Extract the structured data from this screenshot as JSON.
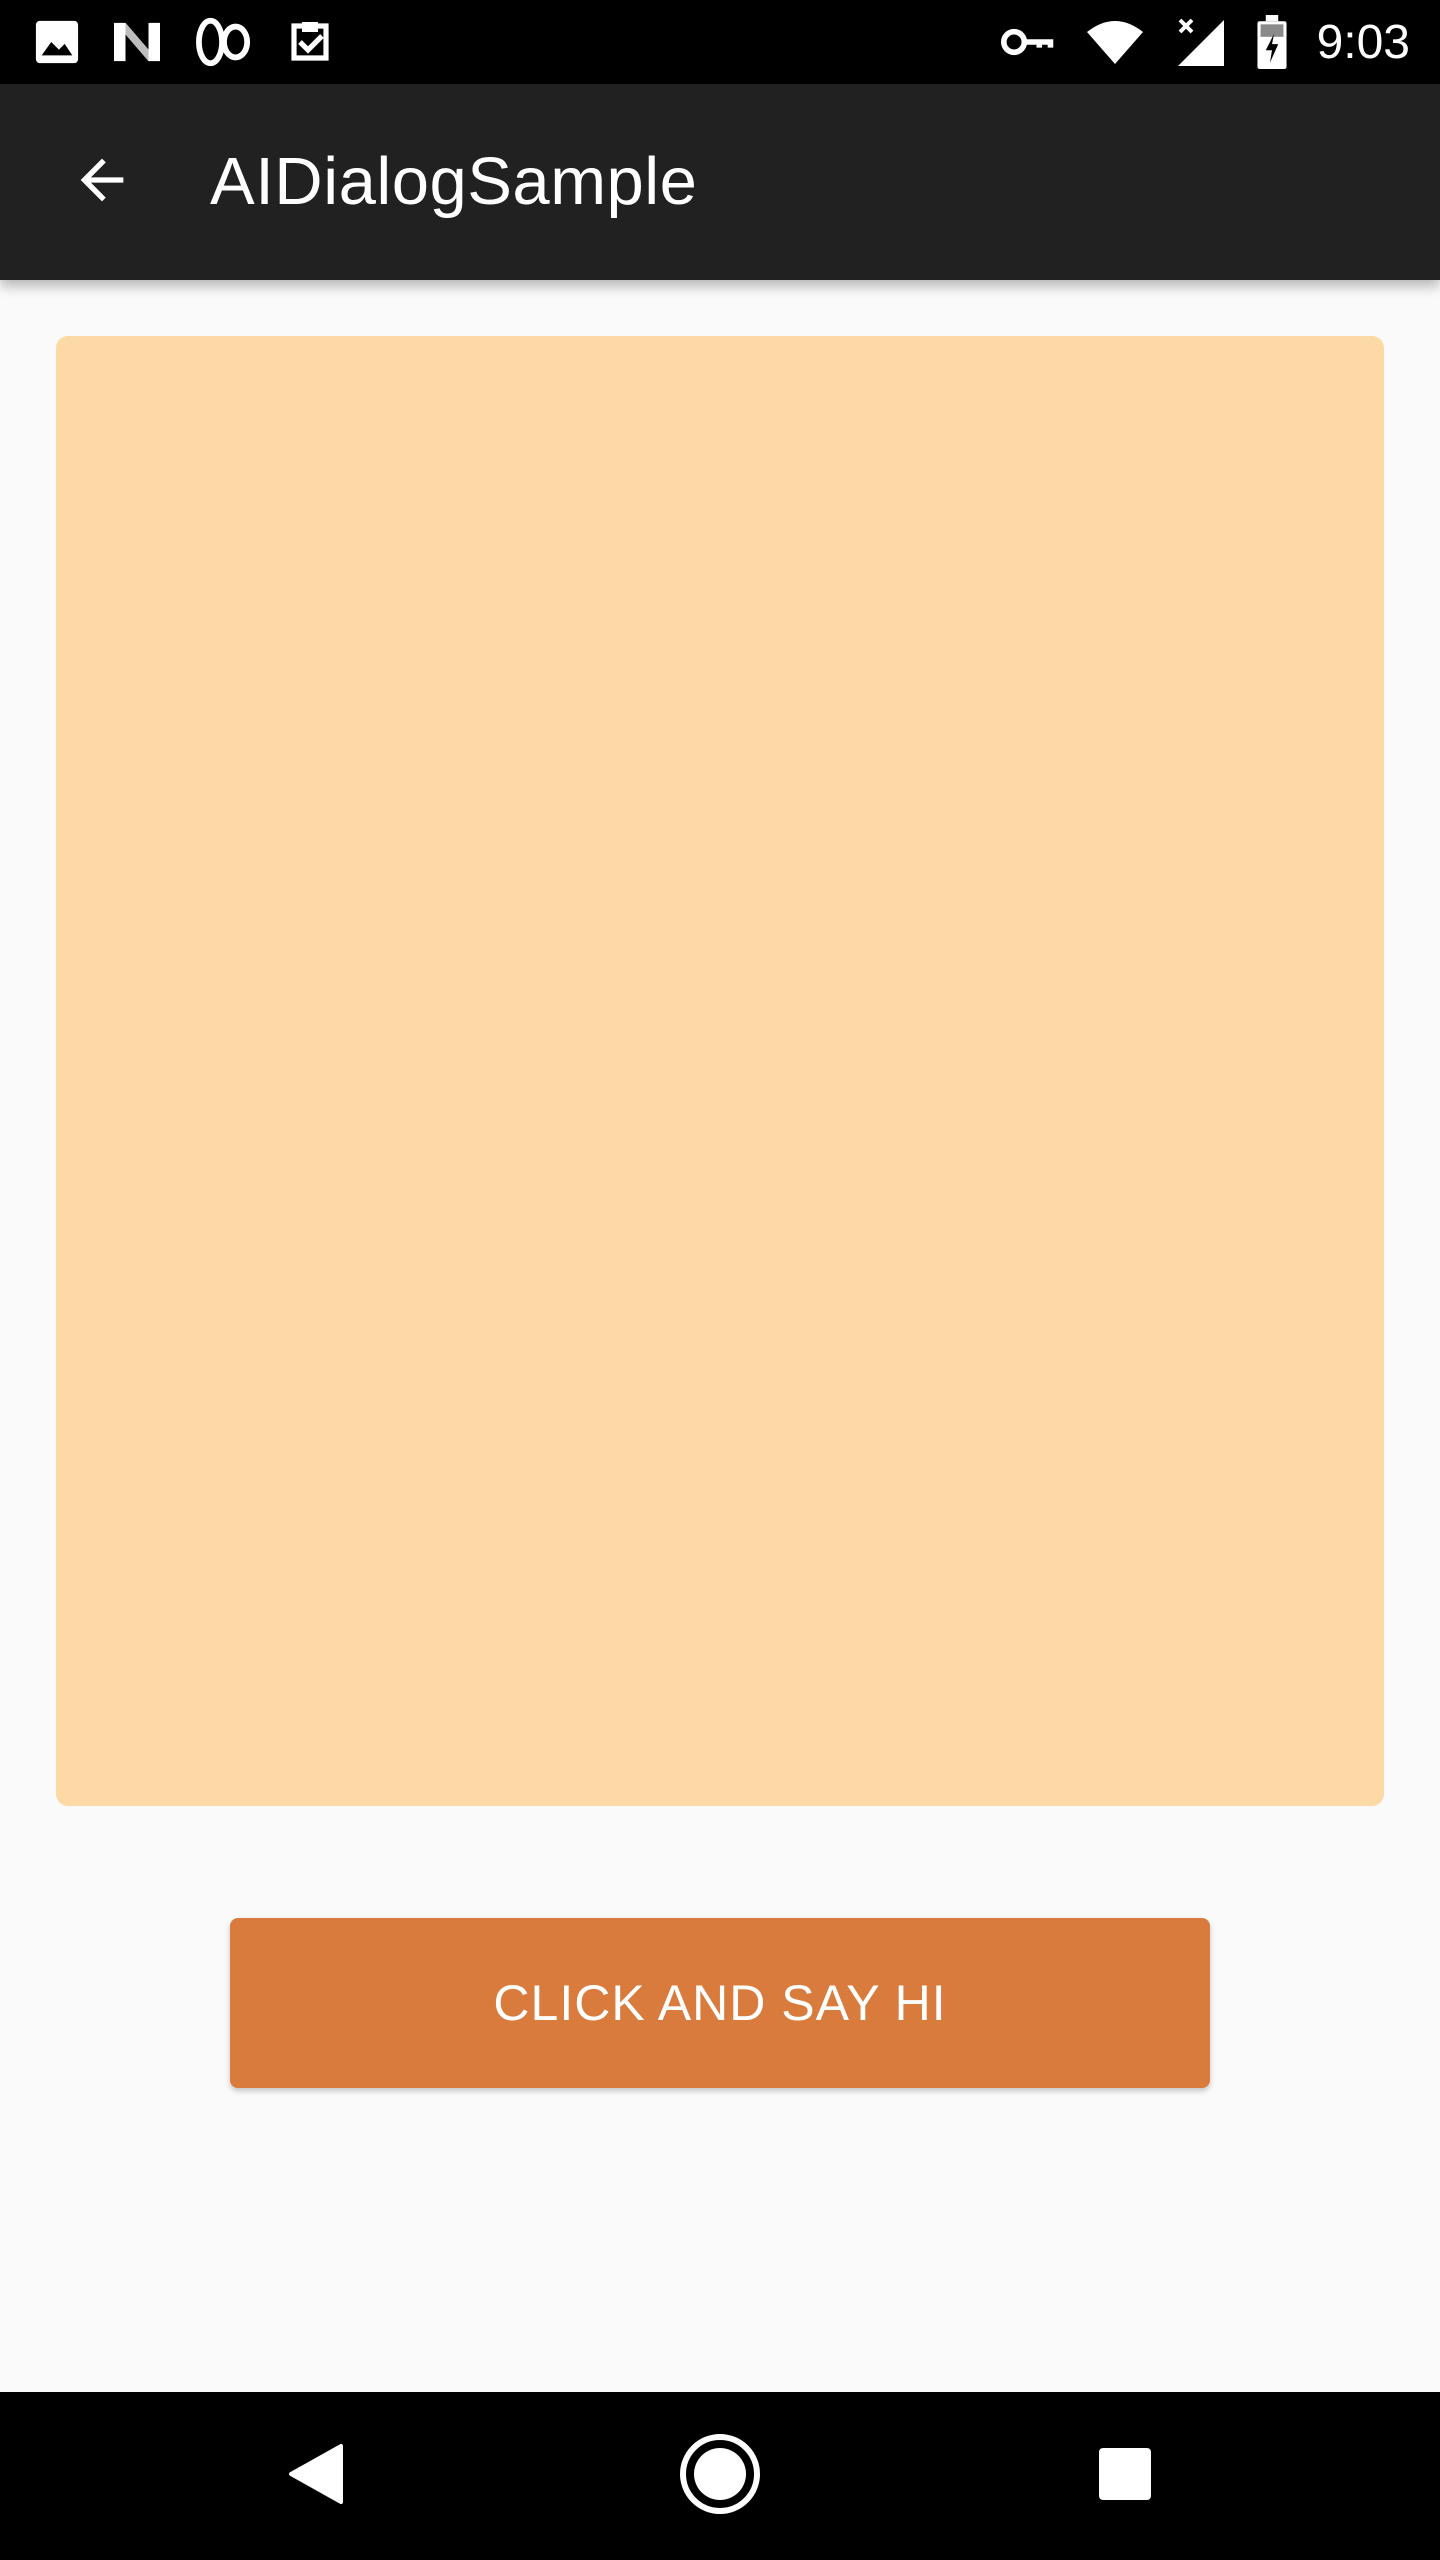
{
  "status_bar": {
    "time": "9:03",
    "left_icons": [
      "image-icon",
      "n-logo-icon",
      "infinity-icon",
      "clipboard-check-icon"
    ],
    "right_icons": [
      "vpn-key-icon",
      "wifi-icon",
      "signal-icon",
      "battery-charging-icon"
    ]
  },
  "app_bar": {
    "title": "AIDialogSample",
    "back_icon": "arrow-back-icon"
  },
  "main": {
    "card_color": "#fdd9a6",
    "button_label": "CLICK AND SAY HI",
    "button_color": "#d97b3d"
  },
  "nav_bar": {
    "icons": [
      "back-triangle-icon",
      "home-circle-icon",
      "recents-square-icon"
    ]
  }
}
